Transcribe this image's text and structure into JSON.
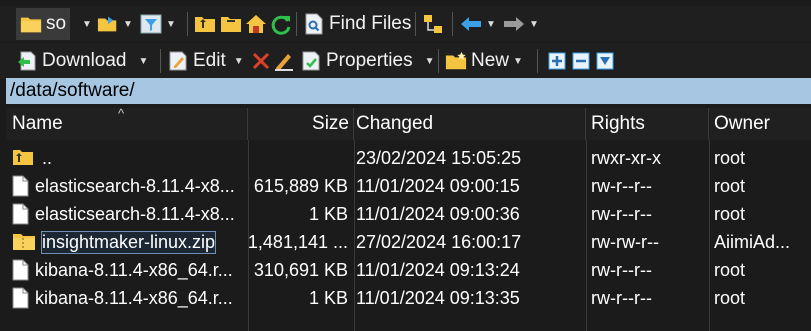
{
  "toolbar1": {
    "folder_label": "so",
    "find_files_label": "Find Files"
  },
  "toolbar2": {
    "download_label": "Download",
    "edit_label": "Edit",
    "properties_label": "Properties",
    "new_label": "New"
  },
  "path": "/data/software/",
  "columns": {
    "name": "Name",
    "size": "Size",
    "changed": "Changed",
    "rights": "Rights",
    "owner": "Owner"
  },
  "rows": [
    {
      "name": "..",
      "size": "",
      "changed": "23/02/2024 15:05:25",
      "rights": "rwxr-xr-x",
      "owner": "root",
      "icon": "parent-folder-icon"
    },
    {
      "name": "elasticsearch-8.11.4-x8...",
      "size": "615,889 KB",
      "changed": "11/01/2024 09:00:15",
      "rights": "rw-r--r--",
      "owner": "root",
      "icon": "file-icon"
    },
    {
      "name": "elasticsearch-8.11.4-x8...",
      "size": "1 KB",
      "changed": "11/01/2024 09:00:36",
      "rights": "rw-r--r--",
      "owner": "root",
      "icon": "file-icon"
    },
    {
      "name": "insightmaker-linux.zip",
      "size": "1,481,141 ...",
      "changed": "27/02/2024 16:00:17",
      "rights": "rw-rw-r--",
      "owner": "AiimiAd...",
      "icon": "zip-folder-icon"
    },
    {
      "name": "kibana-8.11.4-x86_64.r...",
      "size": "310,691 KB",
      "changed": "11/01/2024 09:13:24",
      "rights": "rw-r--r--",
      "owner": "root",
      "icon": "file-icon"
    },
    {
      "name": "kibana-8.11.4-x86_64.r...",
      "size": "1 KB",
      "changed": "11/01/2024 09:13:35",
      "rights": "rw-r--r--",
      "owner": "root",
      "icon": "file-icon"
    }
  ],
  "colors": {
    "path_bar": "#a6c6e2",
    "folder_yellow": "#f5c542",
    "accent_blue": "#3aa0e8",
    "refresh_green": "#2fbf4a",
    "delete_red": "#e0402a"
  }
}
